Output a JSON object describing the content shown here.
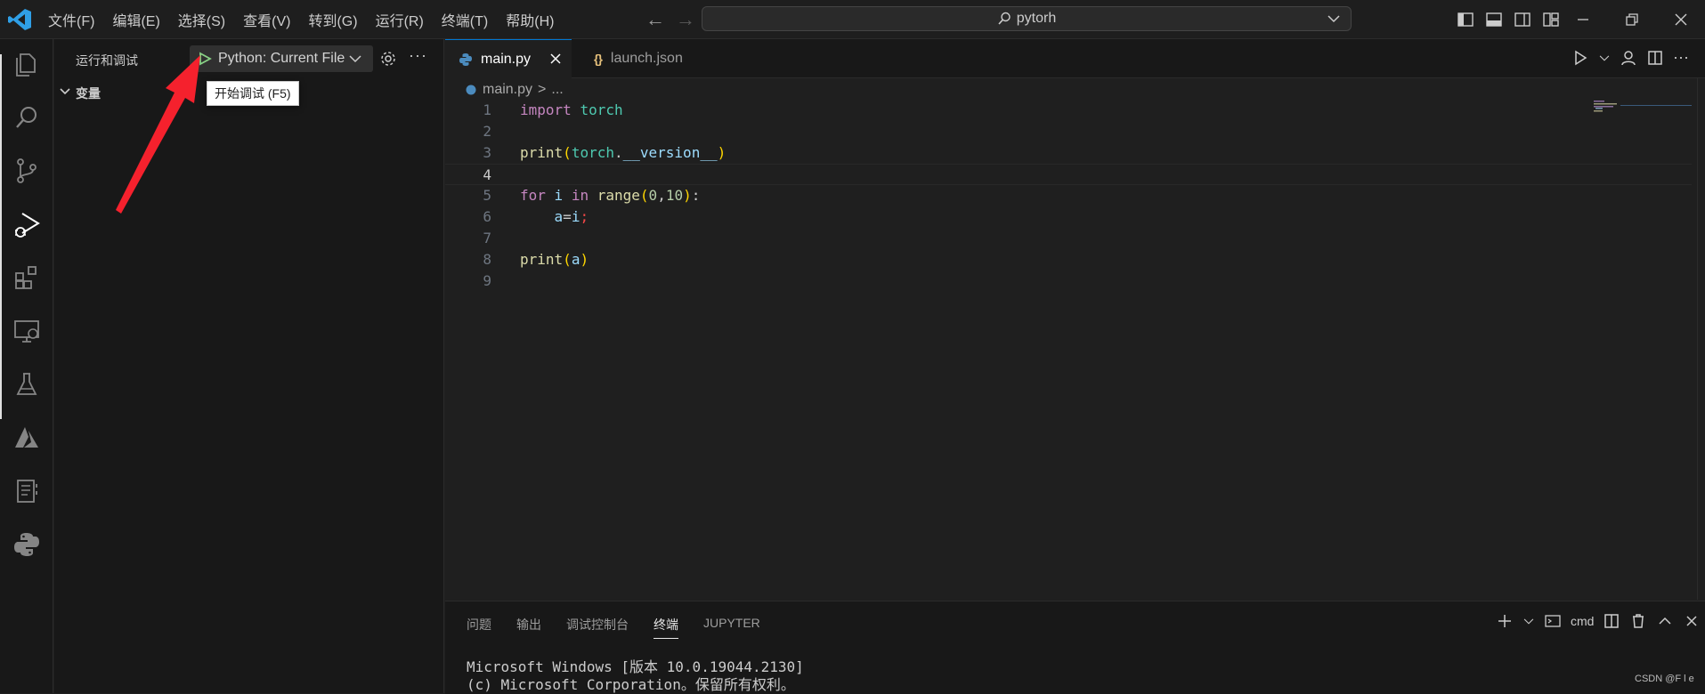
{
  "menu": [
    "文件(F)",
    "编辑(E)",
    "选择(S)",
    "查看(V)",
    "转到(G)",
    "运行(R)",
    "终端(T)",
    "帮助(H)"
  ],
  "command_center": {
    "text": "pytorh"
  },
  "sidebar": {
    "title": "运行和调试",
    "debug_config": "Python: Current File",
    "variables_section": "变量",
    "tooltip": "开始调试 (F5)"
  },
  "tabs": [
    {
      "label": "main.py",
      "active": true
    },
    {
      "label": "launch.json",
      "active": false
    }
  ],
  "breadcrumb": {
    "file": "main.py",
    "sep": ">",
    "rest": "..."
  },
  "code": {
    "line_numbers": [
      "1",
      "2",
      "3",
      "4",
      "5",
      "6",
      "7",
      "8",
      "9"
    ],
    "current_line": "4",
    "lines": [
      "import torch",
      "",
      "print(torch.__version__)",
      "",
      "for i in range(0,10):",
      "    a=i;",
      "",
      "print(a)",
      ""
    ]
  },
  "panel": {
    "tabs": [
      "问题",
      "输出",
      "调试控制台",
      "终端",
      "JUPYTER"
    ],
    "active_tab": "终端",
    "terminal_name": "cmd",
    "terminal_lines": [
      "Microsoft Windows [版本 10.0.19044.2130]",
      "(c) Microsoft Corporation。保留所有权利。"
    ]
  },
  "watermark": "CSDN @F l e",
  "colors": {
    "accent": "#0078d4",
    "play": "#89d185",
    "arrow": "#f5212d"
  }
}
